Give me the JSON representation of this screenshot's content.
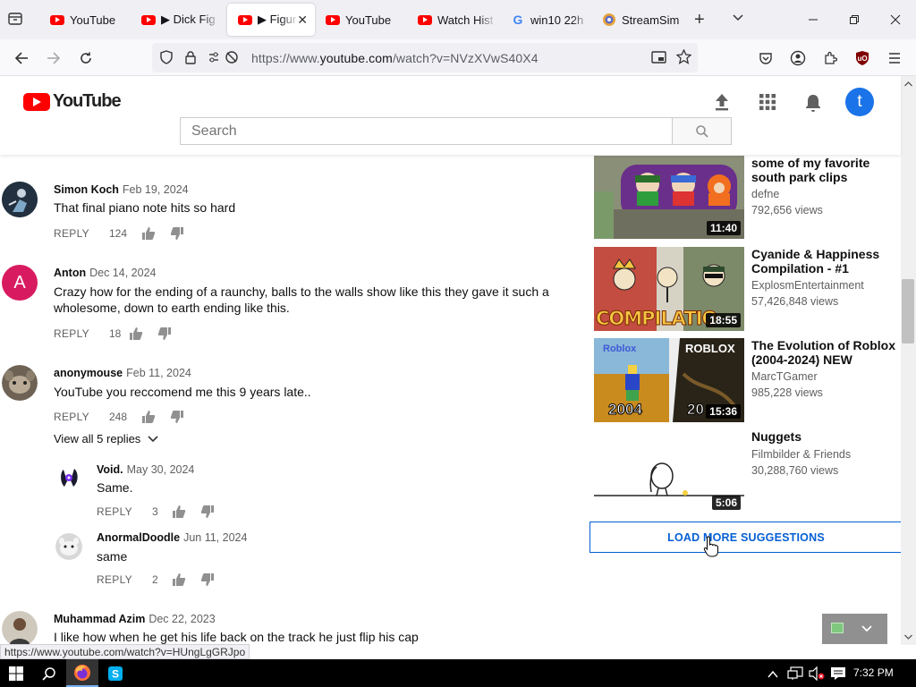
{
  "browser": {
    "tabs": [
      {
        "label": "YouTube",
        "icon": "youtube-favicon"
      },
      {
        "label": "▶ Dick Fig",
        "icon": "youtube-favicon"
      },
      {
        "label": "▶ Figur",
        "icon": "youtube-favicon",
        "active": true
      },
      {
        "label": "YouTube",
        "icon": "youtube-favicon"
      },
      {
        "label": "Watch Hist",
        "icon": "youtube-favicon"
      },
      {
        "label": "win10 22h",
        "icon": "google-favicon"
      },
      {
        "label": "StreamSim",
        "icon": "streamsim-favicon"
      }
    ],
    "url_prefix": "https://www.",
    "url_domain": "youtube.com",
    "url_rest": "/watch?v=NVzXVwS40X4",
    "status_url": "https://www.youtube.com/watch?v=HUngLgGRJpo"
  },
  "youtube": {
    "logo_text": "YouTube",
    "search_placeholder": "Search",
    "avatar_letter": "t"
  },
  "comments": [
    {
      "author": "Simon Koch",
      "date": "Feb 19, 2024",
      "text": "That final piano note hits so hard",
      "likes": "124",
      "reply": "REPLY"
    },
    {
      "author": "Anton",
      "date": "Dec 14, 2024",
      "text": "Crazy how for the ending of a raunchy, balls to the walls show like this they gave it such a wholesome, down to earth ending like this.",
      "likes": "18",
      "reply": "REPLY",
      "avatar_letter": "A"
    },
    {
      "author": "anonymouse",
      "date": "Feb 11, 2024",
      "text": "YouTube you reccomend me this 9 years late..",
      "likes": "248",
      "reply": "REPLY",
      "view_replies": "View all 5 replies"
    },
    {
      "author": "Void.",
      "date": "May 30, 2024",
      "text": "Same.",
      "likes": "3",
      "reply": "REPLY"
    },
    {
      "author": "AnormalDoodle",
      "date": "Jun 11, 2024",
      "text": "same",
      "likes": "2",
      "reply": "REPLY"
    },
    {
      "author": "Muhammad Azim",
      "date": "Dec 22, 2023",
      "text": "I like how when he get his life back on the track he just flip his cap"
    }
  ],
  "suggestions": [
    {
      "title": "some of my favorite south park clips",
      "channel": "defne",
      "views": "792,656 views",
      "duration": "11:40"
    },
    {
      "title": "Cyanide & Happiness Compilation - #1",
      "channel": "ExplosmEntertainment",
      "views": "57,426,848 views",
      "duration": "18:55",
      "thumb_text": "COMPILATIO"
    },
    {
      "title": "The Evolution of Roblox (2004-2024) NEW",
      "channel": "MarcTGamer",
      "views": "985,228 views",
      "duration": "15:36",
      "thumb_left": "2004",
      "thumb_right": "20",
      "thumb_top": "ROBLOX",
      "thumb_top_small": "Roblox"
    },
    {
      "title": "Nuggets",
      "channel": "Filmbilder & Friends",
      "views": "30,288,760 views",
      "duration": "5:06"
    }
  ],
  "load_more_label": "LOAD MORE SUGGESTIONS",
  "taskbar": {
    "time": "7:32 PM"
  },
  "colors": {
    "youtube_red": "#ff0000",
    "link_blue": "#065fd4",
    "avatar_blue": "#1a73e8",
    "anton_avatar": "#d81b60"
  }
}
